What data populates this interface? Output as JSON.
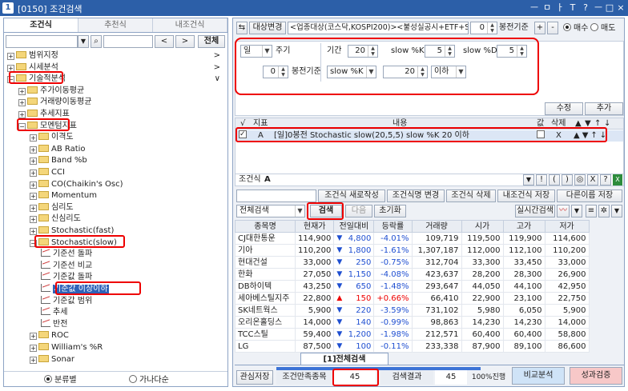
{
  "window": {
    "number": "1",
    "title": "[0150] 조건검색",
    "buttons": [
      "ㅡ",
      "ㅁ",
      "ㅏ",
      "T",
      "?",
      "ㅡ",
      "□",
      "×"
    ]
  },
  "left": {
    "tabs": [
      "조건식",
      "추천식",
      "내조건식"
    ],
    "search": {
      "value": "",
      "prev": "<",
      "next": ">",
      "all": "전체"
    },
    "tree": [
      {
        "label": "범위지정",
        "level": 0,
        "type": "folder",
        "exp": "+",
        "arrow": ">"
      },
      {
        "label": "시세분석",
        "level": 0,
        "type": "folder",
        "exp": "+",
        "arrow": ">"
      },
      {
        "label": "기술적분석",
        "level": 0,
        "type": "folder",
        "exp": "−",
        "arrow": "∨"
      },
      {
        "label": "주가이동평균",
        "level": 1,
        "type": "folder",
        "exp": "+"
      },
      {
        "label": "거래량이동평균",
        "level": 1,
        "type": "folder",
        "exp": "+"
      },
      {
        "label": "추세지표",
        "level": 1,
        "type": "folder",
        "exp": "+"
      },
      {
        "label": "모멘텀지표",
        "level": 1,
        "type": "folder",
        "exp": "−"
      },
      {
        "label": "이격도",
        "level": 2,
        "type": "folder",
        "exp": "+"
      },
      {
        "label": "AB Ratio",
        "level": 2,
        "type": "folder",
        "exp": "+"
      },
      {
        "label": "Band %b",
        "level": 2,
        "type": "folder",
        "exp": "+"
      },
      {
        "label": "CCI",
        "level": 2,
        "type": "folder",
        "exp": "+"
      },
      {
        "label": "CO(Chaikin's Osc)",
        "level": 2,
        "type": "folder",
        "exp": "+"
      },
      {
        "label": "Momentum",
        "level": 2,
        "type": "folder",
        "exp": "+"
      },
      {
        "label": "심리도",
        "level": 2,
        "type": "folder",
        "exp": "+"
      },
      {
        "label": "신심리도",
        "level": 2,
        "type": "folder",
        "exp": "+"
      },
      {
        "label": "Stochastic(fast)",
        "level": 2,
        "type": "folder",
        "exp": "+"
      },
      {
        "label": "Stochastic(slow)",
        "level": 2,
        "type": "folder",
        "exp": "−"
      },
      {
        "label": "기준선 돌파",
        "level": 3,
        "type": "leaf"
      },
      {
        "label": "기준선 비교",
        "level": 3,
        "type": "leaf"
      },
      {
        "label": "기준값 돌파",
        "level": 3,
        "type": "leaf"
      },
      {
        "label": "기준값 이상이하",
        "level": 3,
        "type": "leaf",
        "selected": true
      },
      {
        "label": "기준값 범위",
        "level": 3,
        "type": "leaf"
      },
      {
        "label": "추세",
        "level": 3,
        "type": "leaf"
      },
      {
        "label": "반전",
        "level": 3,
        "type": "leaf"
      },
      {
        "label": "ROC",
        "level": 2,
        "type": "folder",
        "exp": "+"
      },
      {
        "label": "William's %R",
        "level": 2,
        "type": "folder",
        "exp": "+"
      },
      {
        "label": "Sonar",
        "level": 2,
        "type": "folder",
        "exp": "+"
      }
    ],
    "radios": [
      {
        "label": "분류별",
        "on": true
      },
      {
        "label": "가나다순",
        "on": false
      }
    ]
  },
  "right": {
    "top": {
      "change_target": "대상변경",
      "target_text": "<업종대상(코스닥,KOSPI200)><불성실공시+ETF+SP",
      "bong_value": "0",
      "bong_label": "봉전기준",
      "plus": "+",
      "minus": "-",
      "buy": "매수",
      "sell": "매도"
    },
    "settings": {
      "period_type": "일",
      "period_label": "주기",
      "bong_value": "0",
      "bong_label": "봉전기준",
      "term_label": "기간",
      "term_value": "20",
      "k_label": "slow %K",
      "k_value": "5",
      "d_label": "slow %D",
      "d_value": "5",
      "indicator": "slow %K",
      "threshold": "20",
      "compare": "이하",
      "edit": "수정",
      "add": "추가"
    },
    "cond_table": {
      "headers": [
        "√",
        "지표",
        "내용",
        "값",
        "삭제",
        "▲",
        "▼",
        "↑",
        "↓"
      ],
      "rows": [
        {
          "checked": true,
          "index": "A",
          "content": "[일]0봉전 Stochastic slow(20,5,5) slow %K 20 이하",
          "val": "",
          "del": "X",
          "arrows": "▲▼↑↓"
        }
      ]
    },
    "formula": {
      "label": "조건식",
      "value": "A",
      "buttons": [
        "▼",
        "!",
        "(",
        ")",
        "◎",
        "X",
        "?"
      ]
    },
    "actions": [
      "조건식 새로작성",
      "조건식명 변경",
      "조건식 삭제",
      "내조건식 저장",
      "다른이름 저장"
    ],
    "search_bar": {
      "scope": "전체검색",
      "search": "검색",
      "next": "다음",
      "reset": "초기화",
      "realtime": "실시간검색"
    },
    "results": {
      "headers": [
        "종목명",
        "현재가",
        "전일대비",
        "등락률",
        "거래량",
        "시가",
        "고가",
        "저가"
      ],
      "rows": [
        {
          "name": "CJ대한통운",
          "price": "114,900",
          "dir": "dn",
          "diff": "4,800",
          "rate": "-4.01%",
          "volume": "109,719",
          "open": "119,500",
          "high": "119,900",
          "low": "114,600"
        },
        {
          "name": "기아",
          "price": "110,200",
          "dir": "dn",
          "diff": "1,800",
          "rate": "-1.61%",
          "volume": "1,307,187",
          "open": "112,000",
          "high": "112,100",
          "low": "110,200"
        },
        {
          "name": "현대건설",
          "price": "33,000",
          "dir": "dn",
          "diff": "250",
          "rate": "-0.75%",
          "volume": "312,704",
          "open": "33,300",
          "high": "33,450",
          "low": "33,000"
        },
        {
          "name": "한화",
          "price": "27,050",
          "dir": "dn",
          "diff": "1,150",
          "rate": "-4.08%",
          "volume": "423,637",
          "open": "28,200",
          "high": "28,300",
          "low": "26,900"
        },
        {
          "name": "DB하이텍",
          "price": "43,250",
          "dir": "dn",
          "diff": "650",
          "rate": "-1.48%",
          "volume": "293,647",
          "open": "44,050",
          "high": "44,100",
          "low": "42,950"
        },
        {
          "name": "세아베스틸지주",
          "price": "22,800",
          "dir": "up",
          "diff": "150",
          "rate": "+0.66%",
          "volume": "66,410",
          "open": "22,900",
          "high": "23,100",
          "low": "22,750"
        },
        {
          "name": "SK네트웍스",
          "price": "5,900",
          "dir": "dn",
          "diff": "220",
          "rate": "-3.59%",
          "volume": "731,102",
          "open": "5,980",
          "high": "6,050",
          "low": "5,900"
        },
        {
          "name": "오리온홀딩스",
          "price": "14,000",
          "dir": "dn",
          "diff": "140",
          "rate": "-0.99%",
          "volume": "98,863",
          "open": "14,230",
          "high": "14,230",
          "low": "14,000"
        },
        {
          "name": "TCC스틸",
          "price": "59,400",
          "dir": "dn",
          "diff": "1,200",
          "rate": "-1.98%",
          "volume": "212,571",
          "open": "60,400",
          "high": "60,400",
          "low": "58,800"
        },
        {
          "name": "LG",
          "price": "87,500",
          "dir": "dn",
          "diff": "100",
          "rate": "-0.11%",
          "volume": "233,338",
          "open": "87,900",
          "high": "89,100",
          "low": "86,600"
        }
      ]
    },
    "result_tab": "[1]전체검색",
    "bottom": {
      "save": "관심저장",
      "match_label": "조건만족종목",
      "match_value": "45",
      "result_label": "검색결과",
      "result_value": "45",
      "progress": "100%진행",
      "compare": "비교분석",
      "verify": "성과검증"
    }
  },
  "colors": {
    "titlebar": "#2c5fa8",
    "highlight": "#e00000",
    "down": "#1f4fd1",
    "up": "#e00000",
    "selected": "#2f63b8"
  }
}
